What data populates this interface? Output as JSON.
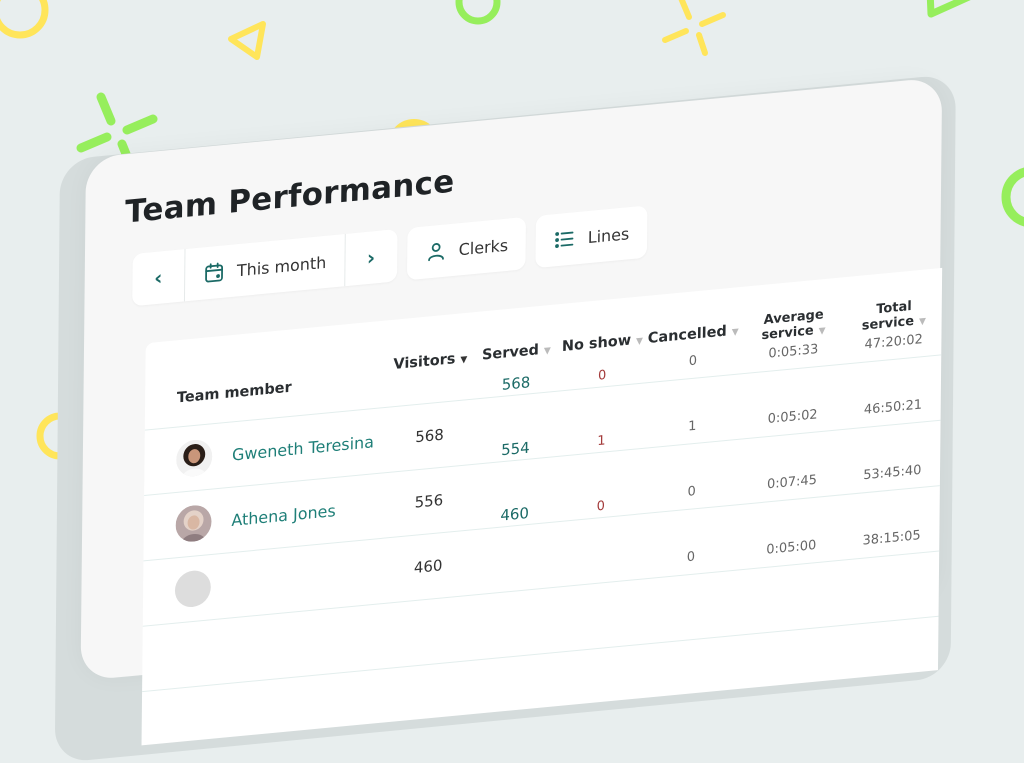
{
  "page": {
    "title": "Team Performance"
  },
  "toolbar": {
    "prev_label": "‹",
    "period_label": "This month",
    "next_label": "›",
    "clerks_label": "Clerks",
    "lines_label": "Lines"
  },
  "icons": {
    "calendar": "calendar-icon",
    "user": "user-icon",
    "list": "list-icon"
  },
  "colors": {
    "accent": "#1b6a66",
    "link": "#1f7f78",
    "negative": "#a33a3a",
    "deco_yellow": "#ffe55a",
    "deco_green": "#96ee5c",
    "background": "#e8eeee",
    "card": "#f7f7f7"
  },
  "table": {
    "columns": [
      {
        "label": "Team member",
        "sortable": false
      },
      {
        "label": "Visitors",
        "sortable": true,
        "active": true
      },
      {
        "label": "Served",
        "sortable": true
      },
      {
        "label": "No show",
        "sortable": true
      },
      {
        "label": "Cancelled",
        "sortable": true
      },
      {
        "label": "Average service",
        "sortable": true
      },
      {
        "label": "Total service",
        "sortable": true
      }
    ],
    "rows": [
      {
        "name": "Gweneth Teresina",
        "visitors": "568",
        "served": "568",
        "no_show": "0",
        "cancelled": "0",
        "average": "0:05:33",
        "total": "47:20:02"
      },
      {
        "name": "Athena Jones",
        "visitors": "556",
        "served": "554",
        "no_show": "1",
        "cancelled": "1",
        "average": "0:05:02",
        "total": "46:50:21"
      },
      {
        "name": "",
        "visitors": "460",
        "served": "460",
        "no_show": "0",
        "cancelled": "0",
        "average": "0:07:45",
        "total": "53:45:40"
      },
      {
        "name": "",
        "visitors": "",
        "served": "",
        "no_show": "",
        "cancelled": "0",
        "average": "0:05:00",
        "total": "38:15:05"
      }
    ]
  }
}
